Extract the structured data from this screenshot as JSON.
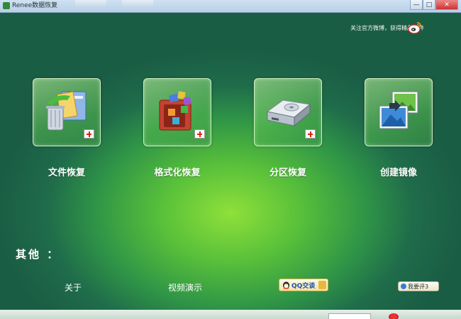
{
  "window": {
    "title": "Renee数据恢复",
    "controls": {
      "minimize": "—",
      "maximize": "□",
      "close": "✕"
    }
  },
  "header": {
    "follow_text": "关注官方微博，获得精品软件",
    "icon": "weibo-icon"
  },
  "features": [
    {
      "label": "文件恢复",
      "icon": "file-recovery-icon"
    },
    {
      "label": "格式化恢复",
      "icon": "format-recovery-icon"
    },
    {
      "label": "分区恢复",
      "icon": "partition-recovery-icon"
    },
    {
      "label": "创建镜像",
      "icon": "create-image-icon"
    }
  ],
  "others": {
    "title": "其他 ：",
    "about": "关于",
    "video_demo": "视频演示",
    "qq_button": "QQ交谈",
    "rate_button": "我要评3"
  },
  "colors": {
    "background_center": "#8fe03a",
    "background_edge": "#1a5d45",
    "text": "#ffffff",
    "plus_badge": "#d21111"
  }
}
